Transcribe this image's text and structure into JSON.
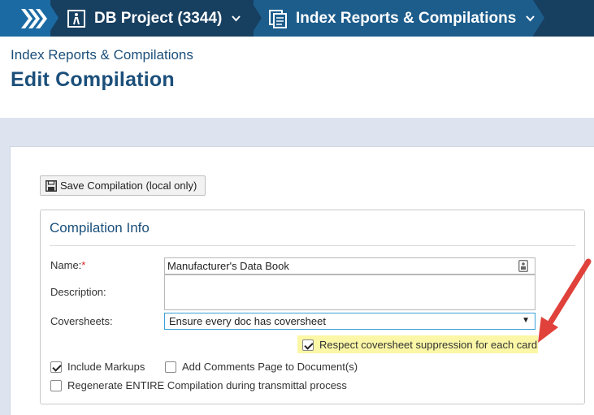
{
  "breadcrumb": {
    "project_label": "DB Project (3344)",
    "module_label": "Index Reports & Compilations"
  },
  "header": {
    "subtitle": "Index Reports & Compilations",
    "title": "Edit Compilation"
  },
  "toolbar": {
    "save_label": "Save Compilation (local only)"
  },
  "compilation_info": {
    "legend": "Compilation Info",
    "name_label": "Name:",
    "required_mark": "*",
    "name_value": "Manufacturer's Data Book",
    "description_label": "Description:",
    "description_value": "",
    "coversheets_label": "Coversheets:",
    "coversheets_value": "Ensure every doc has coversheet",
    "respect_suppression_label": "Respect coversheet suppression for each card",
    "respect_suppression_checked": true,
    "include_markups_label": "Include Markups",
    "include_markups_checked": true,
    "add_comments_label": "Add Comments Page to Document(s)",
    "add_comments_checked": false,
    "regenerate_label": "Regenerate ENTIRE Compilation during transmittal process",
    "regenerate_checked": false
  },
  "colors": {
    "topbar": "#173f60",
    "home_crumb": "#1c6aa3",
    "active_crumb": "#1d5d8c",
    "title_text": "#1b4f7a",
    "highlight": "#fbf7a6",
    "annotation_arrow": "#e0413a"
  },
  "icons": {
    "home": "double-chevron-right-icon",
    "project": "project-person-icon",
    "module": "report-stack-icon",
    "save": "floppy-disk-icon",
    "name_field": "contact-card-icon"
  }
}
